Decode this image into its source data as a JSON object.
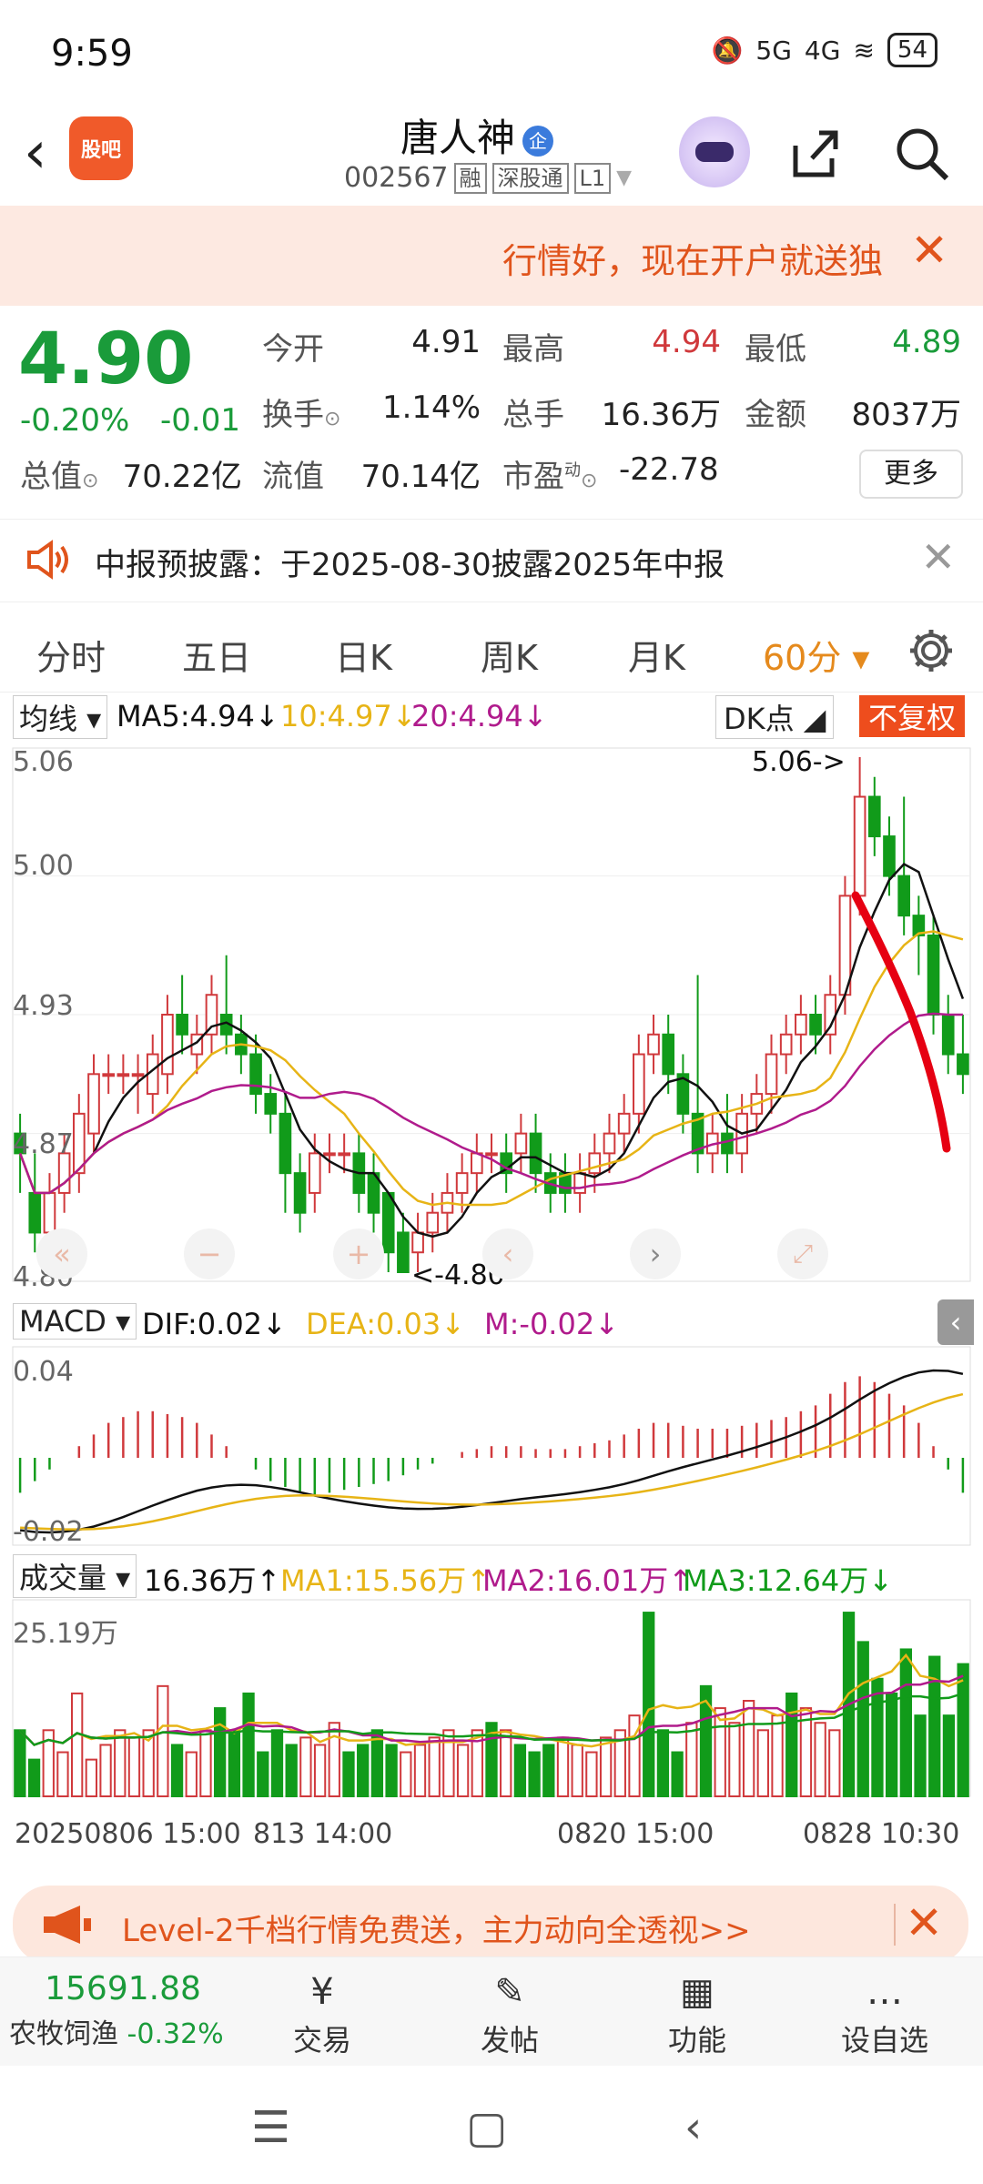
{
  "status": {
    "time": "9:59",
    "net1": "5G",
    "net2": "4G",
    "battery": "54"
  },
  "header": {
    "back": "‹",
    "guba_label": "股吧",
    "name": "唐人神",
    "qi_badge": "企",
    "code": "002567",
    "tags": [
      "融",
      "深股通",
      "L1"
    ]
  },
  "banner": {
    "text": "行情好，现在开户就送独",
    "close": "✕"
  },
  "quote": {
    "price": "4.90",
    "change_pct": "-0.20%",
    "change": "-0.01",
    "open_label": "今开",
    "open": "4.91",
    "high_label": "最高",
    "high": "4.94",
    "low_label": "最低",
    "low": "4.89",
    "turnover_label": "换手",
    "turnover": "1.14%",
    "volume_label": "总手",
    "volume": "16.36万",
    "amount_label": "金额",
    "amount": "8037万",
    "mcap_label": "总值",
    "mcap": "70.22亿",
    "float_label": "流值",
    "float": "70.14亿",
    "pe_label": "市盈",
    "pe_sup": "动",
    "pe": "-22.78",
    "more": "更多"
  },
  "notice": {
    "text": "中报预披露：于2025-08-30披露2025年中报",
    "close": "✕"
  },
  "tabs": [
    {
      "label": "分时"
    },
    {
      "label": "五日"
    },
    {
      "label": "日K"
    },
    {
      "label": "周K"
    },
    {
      "label": "月K"
    },
    {
      "label": "60分 ▾"
    }
  ],
  "kline": {
    "ma_select": "均线 ▾",
    "ma5": "MA5:4.94↓",
    "ma10": "10:4.97↓",
    "ma20": "20:4.94↓",
    "dk": "DK点 ◢",
    "fq": "不复权",
    "y_labels": [
      "5.06",
      "5.00",
      "4.93",
      "4.87",
      "4.80"
    ],
    "high_annot": "5.06->",
    "low_annot": "<-4.80"
  },
  "macd": {
    "select": "MACD ▾",
    "dif": "DIF:0.02↓",
    "dea": "DEA:0.03↓",
    "m": "M:-0.02↓",
    "y_top": "0.04",
    "y_bot": "-0.02"
  },
  "vol": {
    "select": "成交量 ▾",
    "value": "16.36万↑",
    "ma1": "MA1:15.56万↑",
    "ma2": "MA2:16.01万↑",
    "ma3": "MA3:12.64万↓",
    "y_top": "25.19万"
  },
  "x_labels": [
    "20250806 15:00",
    "813 14:00",
    "0820 15:00",
    "0828 10:30"
  ],
  "colors": {
    "up": "#d0393c",
    "down": "#119b1a",
    "ma5": "#111111",
    "ma10": "#e7b416",
    "ma20": "#b01b8c",
    "accent": "#e58a1d"
  },
  "chart_data": {
    "type": "candlestick",
    "interval": "60分",
    "ylim": [
      4.8,
      5.06
    ],
    "candles": [
      {
        "o": 4.87,
        "c": 4.86,
        "h": 4.88,
        "l": 4.84
      },
      {
        "o": 4.84,
        "c": 4.82,
        "h": 4.86,
        "l": 4.81
      },
      {
        "o": 4.82,
        "c": 4.84,
        "h": 4.85,
        "l": 4.81
      },
      {
        "o": 4.84,
        "c": 4.86,
        "h": 4.87,
        "l": 4.83
      },
      {
        "o": 4.85,
        "c": 4.88,
        "h": 4.89,
        "l": 4.84
      },
      {
        "o": 4.87,
        "c": 4.9,
        "h": 4.91,
        "l": 4.86
      },
      {
        "o": 4.9,
        "c": 4.9,
        "h": 4.91,
        "l": 4.89
      },
      {
        "o": 4.9,
        "c": 4.9,
        "h": 4.91,
        "l": 4.89
      },
      {
        "o": 4.9,
        "c": 4.9,
        "h": 4.91,
        "l": 4.88
      },
      {
        "o": 4.89,
        "c": 4.91,
        "h": 4.92,
        "l": 4.88
      },
      {
        "o": 4.9,
        "c": 4.93,
        "h": 4.94,
        "l": 4.89
      },
      {
        "o": 4.93,
        "c": 4.92,
        "h": 4.95,
        "l": 4.91
      },
      {
        "o": 4.91,
        "c": 4.92,
        "h": 4.93,
        "l": 4.9
      },
      {
        "o": 4.92,
        "c": 4.94,
        "h": 4.95,
        "l": 4.91
      },
      {
        "o": 4.93,
        "c": 4.92,
        "h": 4.96,
        "l": 4.91
      },
      {
        "o": 4.92,
        "c": 4.91,
        "h": 4.93,
        "l": 4.9
      },
      {
        "o": 4.91,
        "c": 4.89,
        "h": 4.92,
        "l": 4.88
      },
      {
        "o": 4.89,
        "c": 4.88,
        "h": 4.9,
        "l": 4.87
      },
      {
        "o": 4.88,
        "c": 4.85,
        "h": 4.89,
        "l": 4.83
      },
      {
        "o": 4.85,
        "c": 4.83,
        "h": 4.86,
        "l": 4.82
      },
      {
        "o": 4.84,
        "c": 4.86,
        "h": 4.87,
        "l": 4.83
      },
      {
        "o": 4.86,
        "c": 4.86,
        "h": 4.87,
        "l": 4.85
      },
      {
        "o": 4.86,
        "c": 4.86,
        "h": 4.87,
        "l": 4.85
      },
      {
        "o": 4.86,
        "c": 4.84,
        "h": 4.87,
        "l": 4.83
      },
      {
        "o": 4.85,
        "c": 4.83,
        "h": 4.86,
        "l": 4.82
      },
      {
        "o": 4.84,
        "c": 4.81,
        "h": 4.84,
        "l": 4.8
      },
      {
        "o": 4.82,
        "c": 4.8,
        "h": 4.83,
        "l": 4.8
      },
      {
        "o": 4.81,
        "c": 4.82,
        "h": 4.83,
        "l": 4.8
      },
      {
        "o": 4.82,
        "c": 4.83,
        "h": 4.84,
        "l": 4.81
      },
      {
        "o": 4.83,
        "c": 4.84,
        "h": 4.85,
        "l": 4.82
      },
      {
        "o": 4.84,
        "c": 4.85,
        "h": 4.86,
        "l": 4.83
      },
      {
        "o": 4.85,
        "c": 4.86,
        "h": 4.87,
        "l": 4.84
      },
      {
        "o": 4.86,
        "c": 4.86,
        "h": 4.87,
        "l": 4.85
      },
      {
        "o": 4.86,
        "c": 4.85,
        "h": 4.87,
        "l": 4.84
      },
      {
        "o": 4.86,
        "c": 4.87,
        "h": 4.88,
        "l": 4.85
      },
      {
        "o": 4.87,
        "c": 4.85,
        "h": 4.88,
        "l": 4.84
      },
      {
        "o": 4.85,
        "c": 4.84,
        "h": 4.86,
        "l": 4.83
      },
      {
        "o": 4.85,
        "c": 4.84,
        "h": 4.86,
        "l": 4.83
      },
      {
        "o": 4.84,
        "c": 4.85,
        "h": 4.86,
        "l": 4.83
      },
      {
        "o": 4.85,
        "c": 4.86,
        "h": 4.87,
        "l": 4.84
      },
      {
        "o": 4.86,
        "c": 4.87,
        "h": 4.88,
        "l": 4.85
      },
      {
        "o": 4.87,
        "c": 4.88,
        "h": 4.89,
        "l": 4.86
      },
      {
        "o": 4.88,
        "c": 4.91,
        "h": 4.92,
        "l": 4.87
      },
      {
        "o": 4.91,
        "c": 4.92,
        "h": 4.93,
        "l": 4.9
      },
      {
        "o": 4.92,
        "c": 4.9,
        "h": 4.93,
        "l": 4.89
      },
      {
        "o": 4.9,
        "c": 4.88,
        "h": 4.91,
        "l": 4.87
      },
      {
        "o": 4.88,
        "c": 4.86,
        "h": 4.95,
        "l": 4.85
      },
      {
        "o": 4.86,
        "c": 4.87,
        "h": 4.88,
        "l": 4.85
      },
      {
        "o": 4.87,
        "c": 4.86,
        "h": 4.89,
        "l": 4.85
      },
      {
        "o": 4.86,
        "c": 4.88,
        "h": 4.89,
        "l": 4.85
      },
      {
        "o": 4.88,
        "c": 4.89,
        "h": 4.9,
        "l": 4.87
      },
      {
        "o": 4.89,
        "c": 4.91,
        "h": 4.92,
        "l": 4.88
      },
      {
        "o": 4.91,
        "c": 4.92,
        "h": 4.93,
        "l": 4.9
      },
      {
        "o": 4.92,
        "c": 4.93,
        "h": 4.94,
        "l": 4.91
      },
      {
        "o": 4.93,
        "c": 4.92,
        "h": 4.94,
        "l": 4.91
      },
      {
        "o": 4.92,
        "c": 4.94,
        "h": 4.95,
        "l": 4.91
      },
      {
        "o": 4.94,
        "c": 4.99,
        "h": 5.0,
        "l": 4.93
      },
      {
        "o": 4.99,
        "c": 5.04,
        "h": 5.06,
        "l": 4.98
      },
      {
        "o": 5.04,
        "c": 5.02,
        "h": 5.05,
        "l": 5.01
      },
      {
        "o": 5.02,
        "c": 5.0,
        "h": 5.03,
        "l": 4.99
      },
      {
        "o": 5.0,
        "c": 4.98,
        "h": 5.04,
        "l": 4.97
      },
      {
        "o": 4.98,
        "c": 4.97,
        "h": 4.99,
        "l": 4.95
      },
      {
        "o": 4.97,
        "c": 4.93,
        "h": 4.98,
        "l": 4.92
      },
      {
        "o": 4.93,
        "c": 4.91,
        "h": 4.94,
        "l": 4.9
      },
      {
        "o": 4.91,
        "c": 4.9,
        "h": 4.93,
        "l": 4.89
      }
    ],
    "macd_hist": [
      -0.012,
      -0.008,
      -0.004,
      0.0,
      0.004,
      0.008,
      0.012,
      0.014,
      0.016,
      0.016,
      0.015,
      0.014,
      0.012,
      0.008,
      0.004,
      0.0,
      -0.004,
      -0.008,
      -0.01,
      -0.012,
      -0.013,
      -0.012,
      -0.011,
      -0.01,
      -0.009,
      -0.008,
      -0.006,
      -0.004,
      -0.002,
      0.0,
      0.002,
      0.003,
      0.004,
      0.004,
      0.004,
      0.003,
      0.003,
      0.003,
      0.004,
      0.005,
      0.006,
      0.008,
      0.01,
      0.012,
      0.012,
      0.011,
      0.01,
      0.01,
      0.01,
      0.011,
      0.012,
      0.013,
      0.014,
      0.016,
      0.018,
      0.022,
      0.026,
      0.028,
      0.026,
      0.022,
      0.018,
      0.012,
      0.004,
      -0.004,
      -0.012
    ],
    "volumes": [
      9,
      5,
      9,
      6,
      14,
      5,
      7,
      9,
      8,
      9,
      15,
      7,
      6,
      9,
      12,
      9,
      14,
      6,
      9,
      7,
      8,
      7,
      10,
      6,
      7,
      9,
      7,
      6,
      7,
      8,
      9,
      7,
      9,
      10,
      9,
      7,
      6,
      7,
      8,
      7,
      6,
      8,
      9,
      11,
      25,
      9,
      6,
      10,
      15,
      12,
      10,
      13,
      9,
      11,
      14,
      12,
      10,
      9,
      25,
      21,
      16,
      14,
      20,
      11,
      19,
      11,
      18
    ]
  },
  "annotation_stroke": "#e60012",
  "bottom": {
    "lv2_text": "Level-2千档行情免费送，主力动向全透视>>",
    "lv2_close": "✕",
    "index_value": "15691.88",
    "index_name": "农牧饲渔",
    "index_change": "-0.32%",
    "nav": [
      {
        "label": "交易",
        "icon": "¥"
      },
      {
        "label": "发帖",
        "icon": "✎"
      },
      {
        "label": "功能",
        "icon": "▦"
      },
      {
        "label": "设自选",
        "icon": "…"
      }
    ]
  }
}
